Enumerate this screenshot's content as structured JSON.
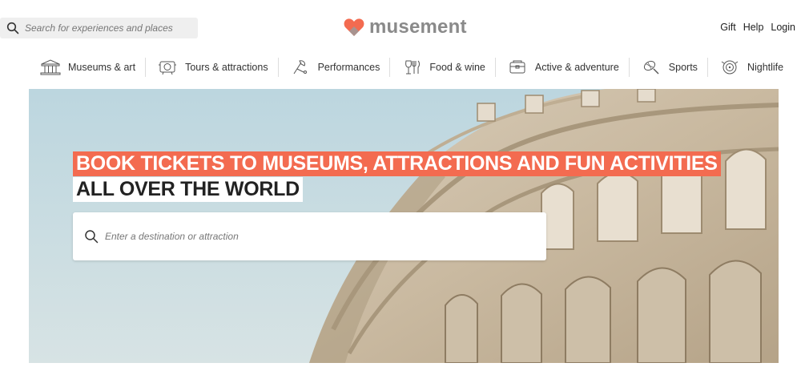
{
  "header": {
    "search": {
      "placeholder": "Search for experiences and places"
    },
    "logo": {
      "text": "musement",
      "heart_color": "#f36b50"
    },
    "links": [
      {
        "label": "Gift"
      },
      {
        "label": "Help"
      },
      {
        "label": "Login"
      }
    ]
  },
  "categories": [
    {
      "label": "Museums & art",
      "icon": "museum-icon"
    },
    {
      "label": "Tours & attractions",
      "icon": "tour-icon"
    },
    {
      "label": "Performances",
      "icon": "performance-icon"
    },
    {
      "label": "Food & wine",
      "icon": "food-icon"
    },
    {
      "label": "Active & adventure",
      "icon": "adventure-icon"
    },
    {
      "label": "Sports",
      "icon": "sports-icon"
    },
    {
      "label": "Nightlife",
      "icon": "nightlife-icon"
    }
  ],
  "hero": {
    "headline_line1": "BOOK TICKETS TO MUSEUMS, ATTRACTIONS AND FUN ACTIVITIES",
    "headline_line2": "ALL OVER THE WORLD",
    "search": {
      "placeholder": "Enter a destination or attraction"
    },
    "accent_color": "#f36b50"
  }
}
